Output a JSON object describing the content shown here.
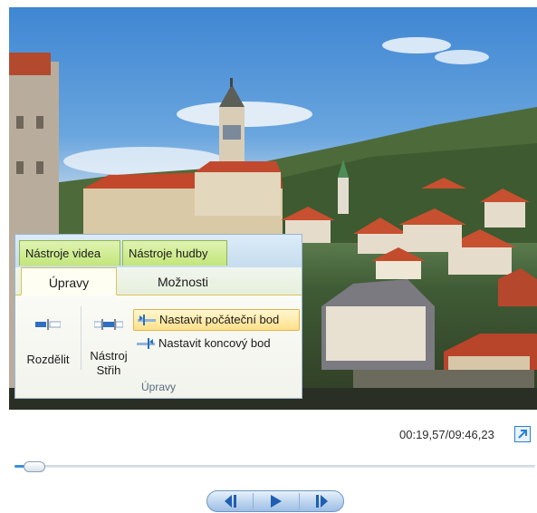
{
  "ribbon": {
    "contextual_tabs": [
      "Nástroje videa",
      "Nástroje hudby"
    ],
    "tabs": [
      "Úpravy",
      "Možnosti"
    ],
    "active_tab": "Úpravy",
    "buttons": {
      "split": "Rozdělit",
      "trim": "Nástroj Střih",
      "set_start": "Nastavit počáteční bod",
      "set_end": "Nastavit koncový bod"
    },
    "group_label": "Úpravy"
  },
  "player": {
    "time": "00:19,57/09:46,23",
    "progress_fraction": 0.034,
    "icons": [
      "fullscreen-icon",
      "previous-frame-icon",
      "play-icon",
      "next-frame-icon"
    ]
  },
  "colors": {
    "accent": "#3a8fd8",
    "ribbon_highlight": "#ffe08a",
    "contextual_green": "#c3e67a"
  }
}
